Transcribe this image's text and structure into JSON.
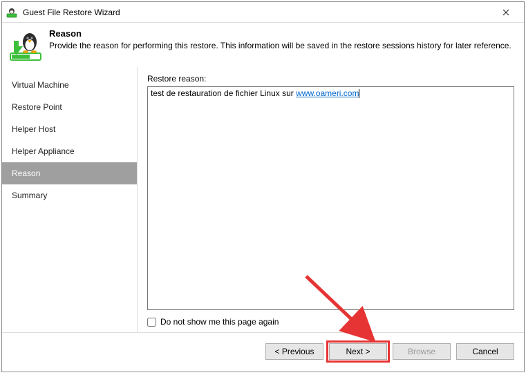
{
  "window": {
    "title": "Guest File Restore Wizard"
  },
  "header": {
    "title": "Reason",
    "description": "Provide the reason for performing this restore. This information will be saved in the restore sessions history for later reference."
  },
  "sidebar": {
    "items": [
      {
        "label": "Virtual Machine",
        "selected": false
      },
      {
        "label": "Restore Point",
        "selected": false
      },
      {
        "label": "Helper Host",
        "selected": false
      },
      {
        "label": "Helper Appliance",
        "selected": false
      },
      {
        "label": "Reason",
        "selected": true
      },
      {
        "label": "Summary",
        "selected": false
      }
    ]
  },
  "main": {
    "reason_label": "Restore reason:",
    "reason_text_prefix": "test de restauration de fichier Linux sur ",
    "reason_link_text": "www.oameri.com",
    "checkbox_label": "Do not show me this page again",
    "checkbox_checked": false
  },
  "footer": {
    "previous": "< Previous",
    "next": "Next >",
    "browse": "Browse",
    "cancel": "Cancel"
  }
}
